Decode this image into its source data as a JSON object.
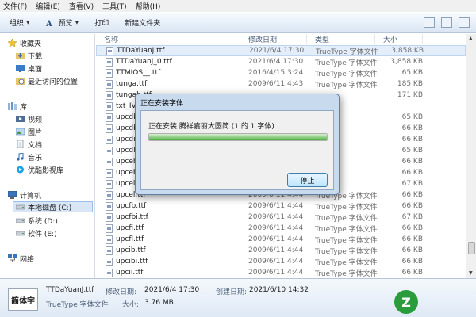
{
  "menu": [
    "文件(F)",
    "编辑(E)",
    "查看(V)",
    "工具(T)",
    "帮助(H)"
  ],
  "toolbar": {
    "organize": "组织",
    "preview": "预览",
    "print": "打印",
    "new_folder": "新建文件夹"
  },
  "sidebar": {
    "favorites": "收藏夹",
    "downloads": "下载",
    "desktop": "桌面",
    "recent": "最近访问的位置",
    "libraries": "库",
    "videos": "视频",
    "pictures": "图片",
    "documents": "文档",
    "music": "音乐",
    "youku": "优酷影视库",
    "computer": "计算机",
    "drive_c": "本地磁盘 (C:)",
    "drive_d": "系统 (D:)",
    "drive_e": "软件 (E:)",
    "network": "网络"
  },
  "columns": {
    "name": "名称",
    "date": "修改日期",
    "type": "类型",
    "size": "大小"
  },
  "files": [
    {
      "name": "TTDaYuanJ.ttf",
      "date": "2021/6/4 17:30",
      "type": "TrueType 字体文件",
      "size": "3,858 KB"
    },
    {
      "name": "TTDaYuanJ_0.ttf",
      "date": "2021/6/4 17:30",
      "type": "TrueType 字体文件",
      "size": "3,858 KB"
    },
    {
      "name": "TTMIOS__.ttf",
      "date": "2016/4/15 3:24",
      "type": "TrueType 字体文件",
      "size": "65 KB"
    },
    {
      "name": "tunga.ttf",
      "date": "2009/6/11 4:43",
      "type": "TrueType 字体文件",
      "size": "185 KB"
    },
    {
      "name": "tungab.ttf",
      "date": "",
      "type": "",
      "size": "171 KB"
    },
    {
      "name": "txt_IV5",
      "date": "",
      "type": "",
      "size": ""
    },
    {
      "name": "upcdb.t",
      "date": "",
      "type": "",
      "size": "65 KB"
    },
    {
      "name": "upcdbi.",
      "date": "",
      "type": "",
      "size": "66 KB"
    },
    {
      "name": "upcdi.t",
      "date": "",
      "type": "",
      "size": "66 KB"
    },
    {
      "name": "upcdl.t",
      "date": "",
      "type": "",
      "size": "65 KB"
    },
    {
      "name": "upceb.t",
      "date": "",
      "type": "",
      "size": "66 KB"
    },
    {
      "name": "upcebi.",
      "date": "",
      "type": "",
      "size": "66 KB"
    },
    {
      "name": "upcei.t",
      "date": "",
      "type": "",
      "size": "67 KB"
    },
    {
      "name": "upcel.ttf",
      "date": "2009/6/11 4:44",
      "type": "TrueType 字体文件",
      "size": "66 KB"
    },
    {
      "name": "upcfb.ttf",
      "date": "2009/6/11 4:44",
      "type": "TrueType 字体文件",
      "size": "66 KB"
    },
    {
      "name": "upcfbi.ttf",
      "date": "2009/6/11 4:44",
      "type": "TrueType 字体文件",
      "size": "67 KB"
    },
    {
      "name": "upcfi.ttf",
      "date": "2009/6/11 4:44",
      "type": "TrueType 字体文件",
      "size": "66 KB"
    },
    {
      "name": "upcfl.ttf",
      "date": "2009/6/11 4:44",
      "type": "TrueType 字体文件",
      "size": "66 KB"
    },
    {
      "name": "upcib.ttf",
      "date": "2009/6/11 4:44",
      "type": "TrueType 字体文件",
      "size": "66 KB"
    },
    {
      "name": "upcibi.ttf",
      "date": "2009/6/11 4:44",
      "type": "TrueType 字体文件",
      "size": "66 KB"
    },
    {
      "name": "upcii.ttf",
      "date": "2009/6/11 4:44",
      "type": "TrueType 字体文件",
      "size": "66 KB"
    }
  ],
  "details": {
    "preview_text": "简体字",
    "filename": "TTDaYuanJ.ttf",
    "filetype": "TrueType 字体文件",
    "modified_label": "修改日期:",
    "modified_value": "2021/6/4 17:30",
    "created_label": "创建日期:",
    "created_value": "2021/6/10 14:32",
    "size_label": "大小:",
    "size_value": "3.76 MB"
  },
  "dialog": {
    "title": "正在安装字体",
    "message": "正在安装 腾祥嘉丽大圆简 (1 的 1 字体)",
    "progress": 1.0,
    "stop_label": "停止"
  },
  "watermark": {
    "logo": "Z"
  },
  "colors": {
    "selection": "#e4eefb",
    "progress_green": "#52b044",
    "dialog_frame": "#c8daee"
  }
}
